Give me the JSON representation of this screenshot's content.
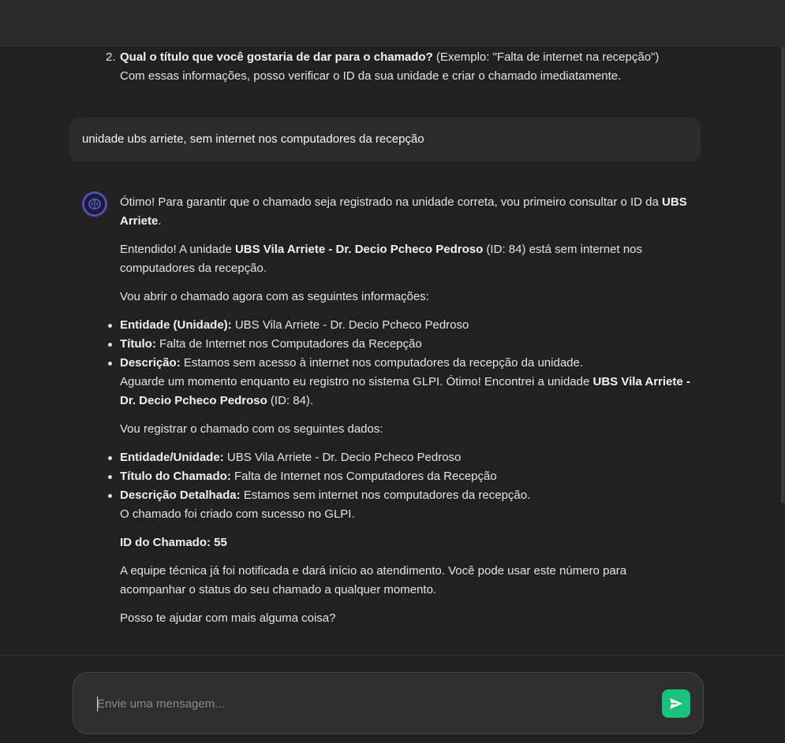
{
  "previous": {
    "item_number": "2.",
    "question_bold": "Qual o título que você gostaria de dar para o chamado?",
    "question_rest": " (Exemplo: \"Falta de internet na recepção\")",
    "followup": "Com essas informações, posso verificar o ID da sua unidade e criar o chamado imediatamente."
  },
  "user_message": "unidade ubs arriete, sem internet nos computadores da recepção",
  "bot": {
    "p1_text": "Ótimo! Para garantir que o chamado seja registrado na unidade correta, vou primeiro consultar o ID da ",
    "p1_bold": "UBS Arriete",
    "p1_end": ".",
    "p2_text": "Entendido! A unidade ",
    "p2_bold": "UBS Vila Arriete - Dr. Decio Pcheco Pedroso",
    "p2_end": " (ID: 84) está sem internet nos computadores da recepção.",
    "p3": "Vou abrir o chamado agora com as seguintes informações:",
    "list1": [
      {
        "label": "Entidade (Unidade):",
        "value": " UBS Vila Arriete - Dr. Decio Pcheco Pedroso"
      },
      {
        "label": "Título:",
        "value": " Falta de Internet nos Computadores da Recepção"
      },
      {
        "label": "Descrição:",
        "value": " Estamos sem acesso à internet nos computadores da recepção da unidade."
      }
    ],
    "list1_cont_text": "Aguarde um momento enquanto eu registro no sistema GLPI. Ótimo! Encontrei a unidade ",
    "list1_cont_bold": "UBS Vila Arriete - Dr. Decio Pcheco Pedroso",
    "list1_cont_end": " (ID: 84).",
    "p4": "Vou registrar o chamado com os seguintes dados:",
    "list2": [
      {
        "label": "Entidade/Unidade:",
        "value": " UBS Vila Arriete - Dr. Decio Pcheco Pedroso"
      },
      {
        "label": "Título do Chamado:",
        "value": " Falta de Internet nos Computadores da Recepção"
      },
      {
        "label": "Descrição Detalhada:",
        "value": " Estamos sem internet nos computadores da recepção."
      }
    ],
    "list2_cont": "O chamado foi criado com sucesso no GLPI.",
    "ticket_id": "ID do Chamado: 55",
    "p5": "A equipe técnica já foi notificada e dará início ao atendimento. Você pode usar este número para acompanhar o status do seu chamado a qualquer momento.",
    "p6": "Posso te ajudar com mais alguma coisa?"
  },
  "input": {
    "placeholder": "Envie uma mensagem..."
  },
  "icons": {
    "send": "send-icon",
    "avatar": "brain-icon"
  },
  "colors": {
    "send_button": "#19c37d",
    "background": "#212121"
  }
}
